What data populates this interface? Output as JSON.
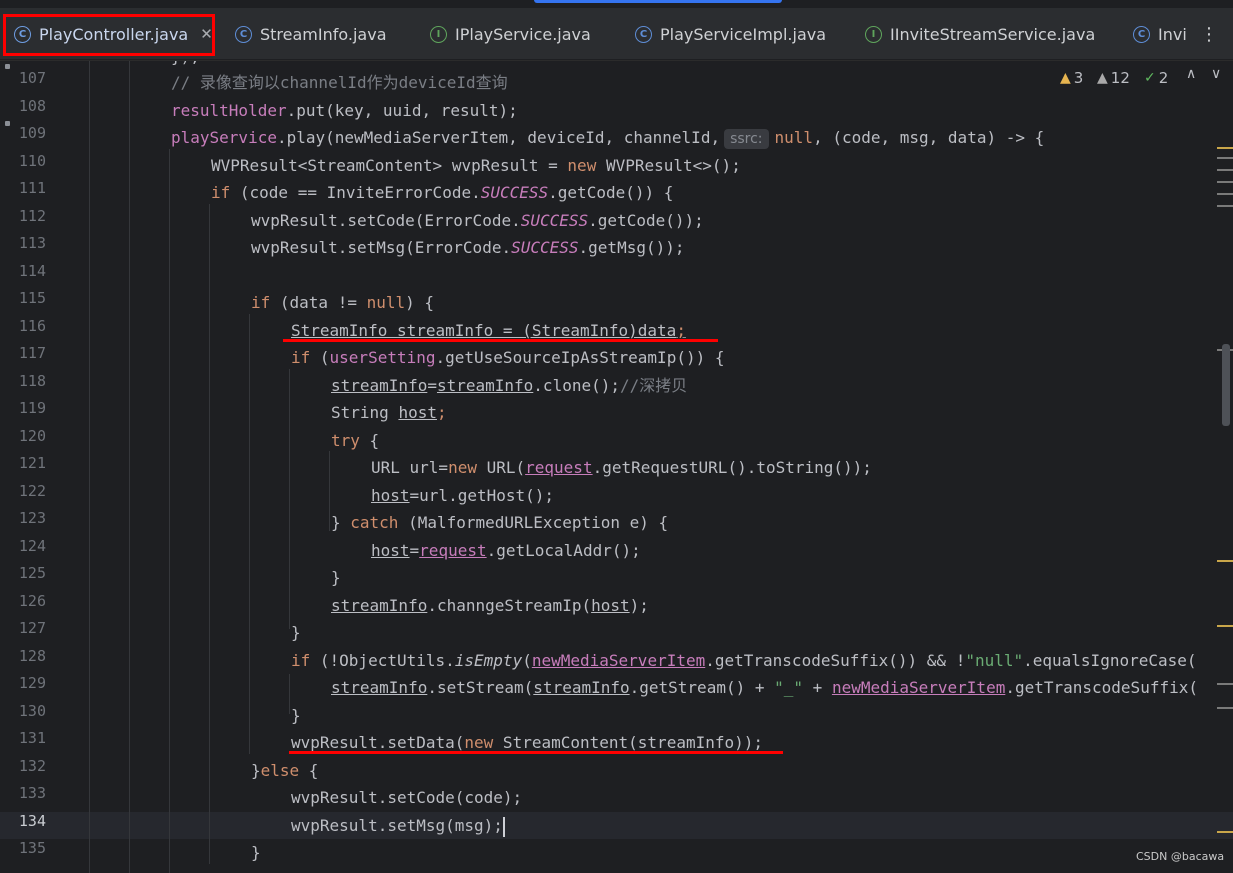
{
  "tabs": [
    {
      "label": "PlayController.java",
      "icon": "class-icon",
      "icon_glyph": "C",
      "active": true
    },
    {
      "label": "StreamInfo.java",
      "icon": "class-icon",
      "icon_glyph": "C"
    },
    {
      "label": "IPlayService.java",
      "icon": "interface-icon",
      "icon_glyph": "I"
    },
    {
      "label": "PlayServiceImpl.java",
      "icon": "class-icon",
      "icon_glyph": "C"
    },
    {
      "label": "IInviteStreamService.java",
      "icon": "interface-icon",
      "icon_glyph": "I"
    },
    {
      "label": "Invi",
      "icon": "class-icon",
      "icon_glyph": "C"
    }
  ],
  "tab_close_glyph": "✕",
  "tab_menu_glyph": "⋮",
  "inspections": {
    "warnings": "3",
    "weak_warnings": "12",
    "ok": "2",
    "warn_glyph": "▲",
    "weak_glyph": "▲",
    "ok_glyph": "✓",
    "up_glyph": "∧",
    "down_glyph": "∨"
  },
  "gutter": {
    "line_numbers": [
      "107",
      "108",
      "109",
      "110",
      "111",
      "112",
      "113",
      "114",
      "115",
      "116",
      "117",
      "118",
      "119",
      "120",
      "121",
      "122",
      "123",
      "124",
      "125",
      "126",
      "127",
      "128",
      "129",
      "130",
      "131",
      "132",
      "133",
      "134",
      "135"
    ],
    "current_line": "134"
  },
  "code": {
    "top_partial": "});",
    "l107_comment": "// 录像查询以channelId作为deviceId查询",
    "l108_field": "resultHolder",
    "l108_rest": ".put(key, uuid, result);",
    "l109_field": "playService",
    "l109_a": ".play(newMediaServerItem, deviceId, channelId,",
    "l109_hint": "ssrc:",
    "l109_null": "null",
    "l109_b": ", (code, msg, data) -> {",
    "l110_a": "WVPResult<StreamContent> wvpResult = ",
    "l110_new": "new",
    "l110_b": " WVPResult<>();",
    "l111_if": "if",
    "l111_a": " (code == InviteErrorCode.",
    "l111_const": "SUCCESS",
    "l111_b": ".getCode()) {",
    "l112_a": "wvpResult.setCode(ErrorCode.",
    "l112_const": "SUCCESS",
    "l112_b": ".getCode());",
    "l113_a": "wvpResult.setMsg(ErrorCode.",
    "l113_const": "SUCCESS",
    "l113_b": ".getMsg());",
    "l115_if": "if",
    "l115_a": " (data != ",
    "l115_null": "null",
    "l115_b": ") {",
    "l116_a": "StreamInfo streamInfo = (StreamInfo)data",
    "l116_semi": ";",
    "l117_if": "if",
    "l117_a": " (",
    "l117_field": "userSetting",
    "l117_b": ".getUseSourceIpAsStreamIp()) {",
    "l118_v1": "streamInfo",
    "l118_eq": "=",
    "l118_v2": "streamInfo",
    "l118_b": ".clone();",
    "l118_cmt": "//深拷贝",
    "l119_a": "String ",
    "l119_v": "host",
    "l119_semi": ";",
    "l120_try": "try",
    "l120_b": " {",
    "l121_a": "URL url=",
    "l121_new": "new",
    "l121_b": " URL(",
    "l121_field": "request",
    "l121_c": ".getRequestURL().toString());",
    "l122_v": "host",
    "l122_b": "=url.getHost();",
    "l123_a": "} ",
    "l123_catch": "catch",
    "l123_b": " (MalformedURLException e) {",
    "l124_v": "host",
    "l124_eq": "=",
    "l124_field": "request",
    "l124_b": ".getLocalAddr();",
    "l125": "}",
    "l126_v": "streamInfo",
    "l126_a": ".channgeStreamIp(",
    "l126_v2": "host",
    "l126_b": ");",
    "l127": "}",
    "l128_if": "if",
    "l128_a": " (!ObjectUtils.",
    "l128_static": "isEmpty",
    "l128_b": "(",
    "l128_field": "newMediaServerItem",
    "l128_c": ".getTranscodeSuffix()) && !",
    "l128_str": "\"null\"",
    "l128_d": ".equalsIgnoreCase(",
    "l129_v": "streamInfo",
    "l129_a": ".setStream(",
    "l129_v2": "streamInfo",
    "l129_b": ".getStream() + ",
    "l129_str": "\"_\"",
    "l129_c": " + ",
    "l129_field": "newMediaServerItem",
    "l129_d": ".getTranscodeSuffix(",
    "l130": "}",
    "l131_a": "wvpResult.setData(",
    "l131_new": "new",
    "l131_b": " StreamContent(streamInfo));",
    "l132_a": "}",
    "l132_else": "else",
    "l132_b": " {",
    "l133": "wvpResult.setCode(code);",
    "l134_a": "wvpResult.setMsg(msg);",
    "l135": "}"
  },
  "watermark": "CSDN @bacawa",
  "colors": {
    "annotation_red": "#ff0000",
    "tab_accent": "#3574f0",
    "editor_bg": "#1e1f22",
    "keyword": "#cf8e6d",
    "field": "#c77dbb",
    "string": "#6aab73",
    "comment": "#7a7e85"
  }
}
